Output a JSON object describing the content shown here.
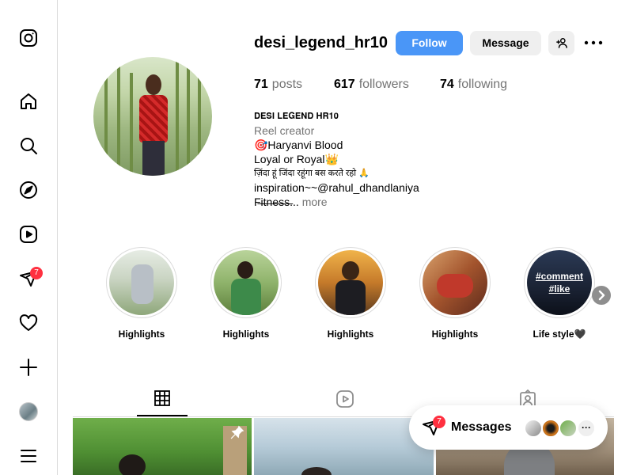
{
  "sidebar": {
    "items": [
      {
        "name": "instagram-logo-icon"
      },
      {
        "name": "home-icon"
      },
      {
        "name": "search-icon"
      },
      {
        "name": "explore-icon"
      },
      {
        "name": "reels-icon"
      },
      {
        "name": "messages-icon",
        "badge": "7"
      },
      {
        "name": "notifications-icon"
      },
      {
        "name": "create-icon"
      },
      {
        "name": "profile-avatar"
      },
      {
        "name": "menu-icon"
      }
    ]
  },
  "profile": {
    "username": "desi_legend_hr10",
    "follow_label": "Follow",
    "message_label": "Message",
    "stats": {
      "posts_count": "71",
      "posts_label": "posts",
      "followers_count": "617",
      "followers_label": "followers",
      "following_count": "74",
      "following_label": "following"
    },
    "bio": {
      "line1": "𝐃𝐄𝐒𝐈 𝐋𝐄𝐆𝐄𝐍𝐃 𝐇𝐑𝟏𝟎",
      "category": "Reel creator",
      "line2": "🎯Haryanvi Blood",
      "line3": "Loyal or Royal👑",
      "line4": "ज़िंदा हूं जिंदा रहूंगा बस करते रहो 🙏",
      "line5": "inspiration~~@rahul_dhandlaniya",
      "line6": "F̶i̶t̶n̶e̶s̶s̶...",
      "more_label": "more"
    }
  },
  "highlights": [
    {
      "label": "Highlights"
    },
    {
      "label": "Highlights"
    },
    {
      "label": "Highlights"
    },
    {
      "label": "Highlights"
    },
    {
      "label": "Life style🖤",
      "overlay1": "#comment",
      "overlay2": "#like"
    }
  ],
  "tabs": [
    {
      "name": "posts",
      "icon": "grid-icon",
      "active": true
    },
    {
      "name": "reels",
      "icon": "reels-icon",
      "active": false
    },
    {
      "name": "tagged",
      "icon": "tagged-icon",
      "active": false
    }
  ],
  "messages_bar": {
    "label": "Messages",
    "badge": "7",
    "more": "···"
  },
  "colors": {
    "follow_button": "#4a96f7",
    "badge": "#ff3040",
    "secondary_text": "#737373",
    "border": "#dbdbdb"
  }
}
